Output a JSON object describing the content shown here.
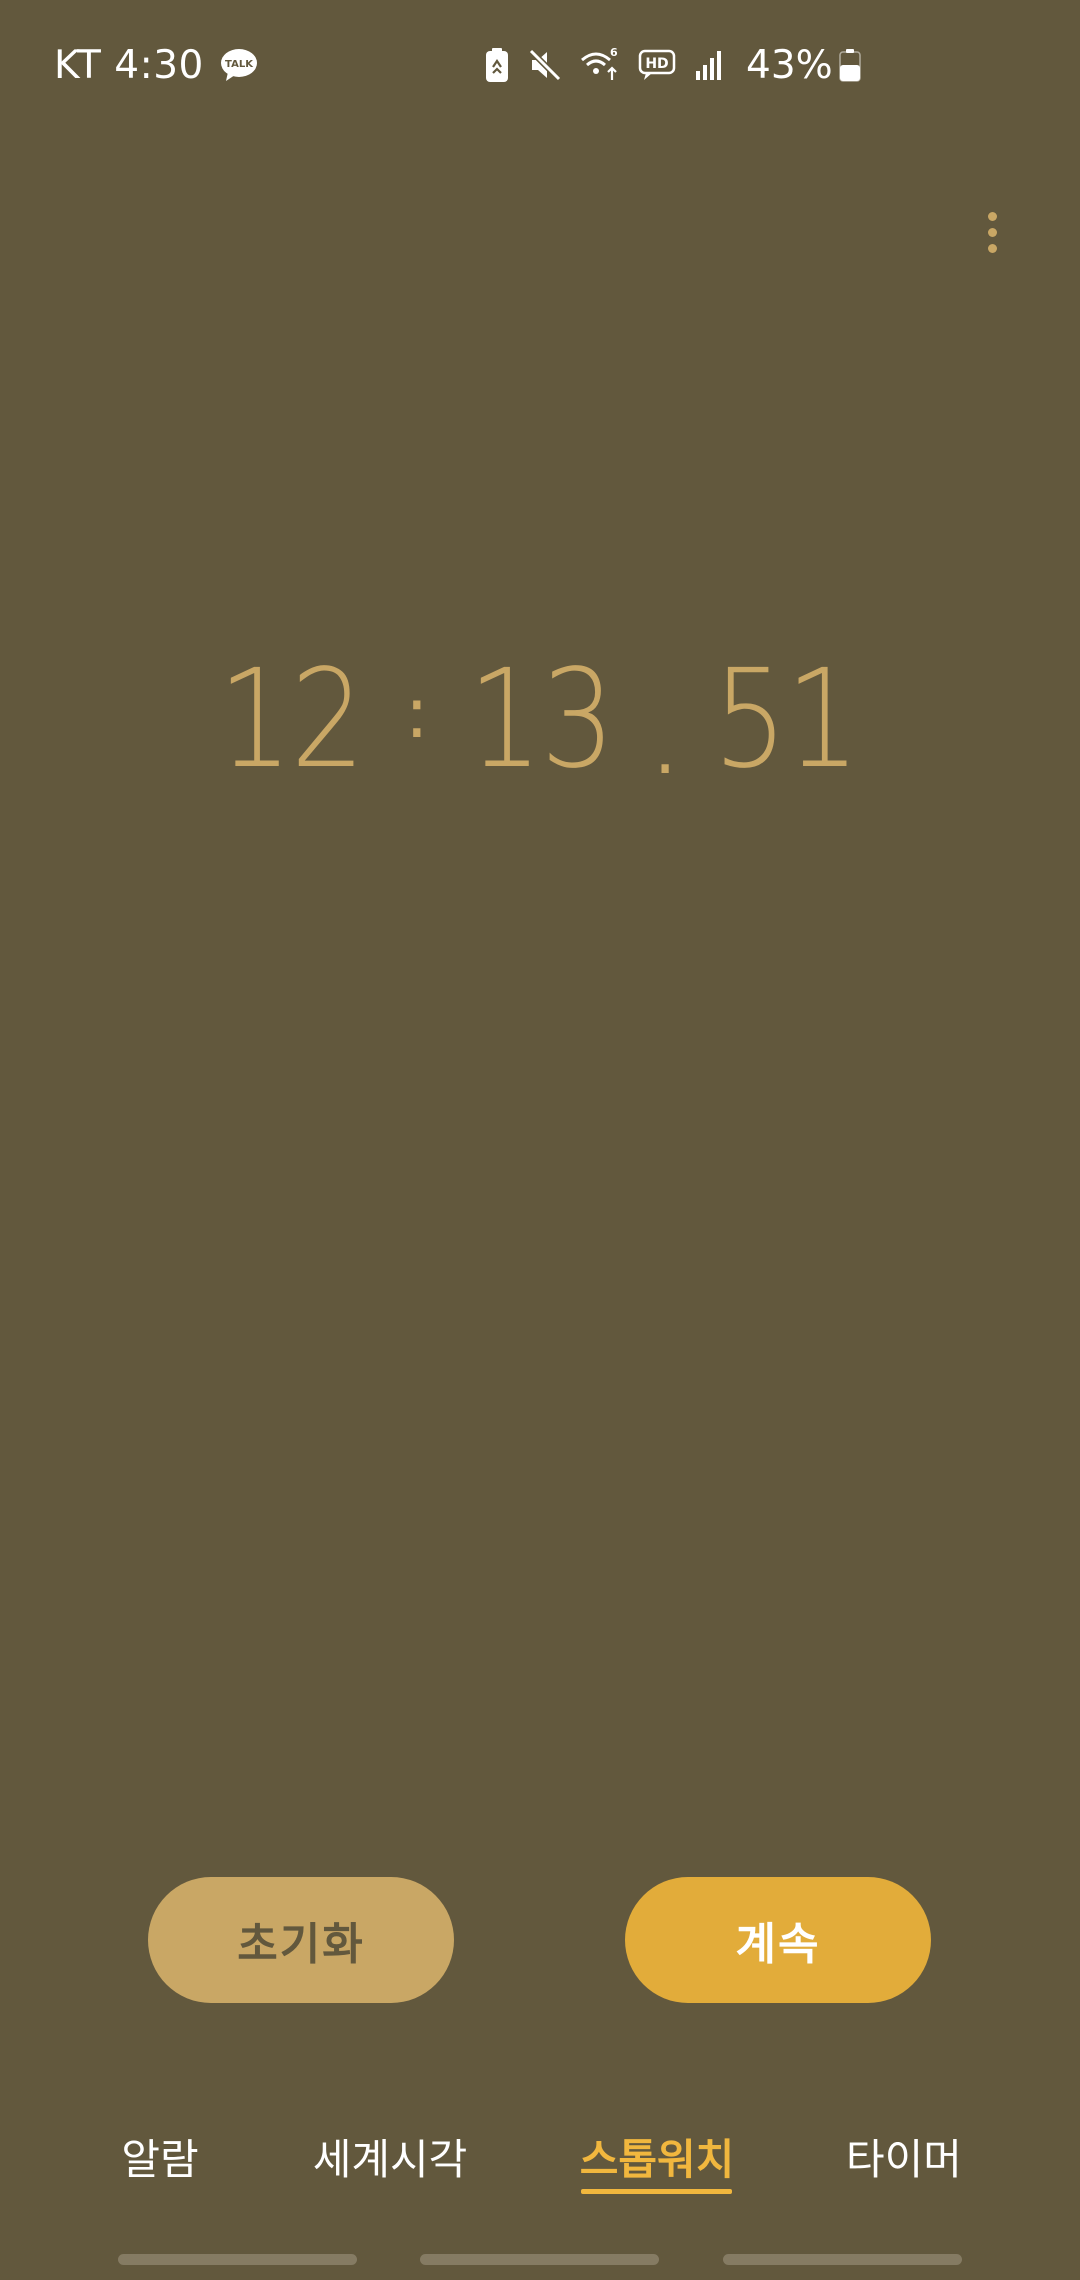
{
  "status_bar": {
    "carrier_time": "KT 4:30",
    "battery_percent": "43%",
    "icons": [
      "kakaotalk-icon",
      "battery-saver-icon",
      "mute-icon",
      "wifi-6-icon",
      "hd-voice-icon",
      "signal-icon",
      "battery-icon"
    ]
  },
  "stopwatch": {
    "hours": "12",
    "minutes": "13",
    "hundredths": "51",
    "colon": ":",
    "dot": "."
  },
  "buttons": {
    "reset_label": "초기화",
    "continue_label": "계속"
  },
  "tabs": [
    {
      "label": "알람",
      "active": false
    },
    {
      "label": "세계시각",
      "active": false
    },
    {
      "label": "스톱워치",
      "active": true
    },
    {
      "label": "타이머",
      "active": false
    }
  ],
  "colors": {
    "background": "#62583d",
    "accent_text": "#c9a765",
    "reset_button": "#c9a765",
    "continue_button": "#e2ac3a",
    "active_tab": "#f1b73e"
  }
}
